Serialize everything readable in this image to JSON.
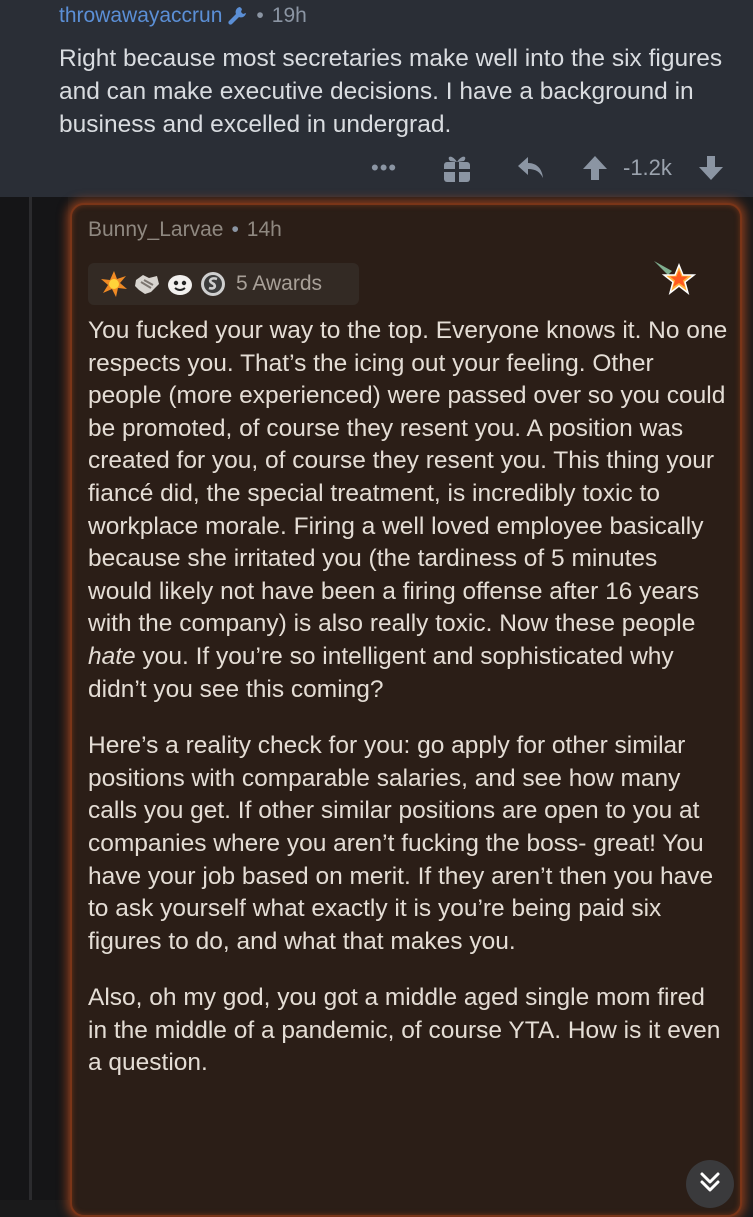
{
  "parent_comment": {
    "username": "throwawayaccrun",
    "separator": "•",
    "age": "19h",
    "body": "Right because most secretaries make well into the six figures and can make executive decisions. I have a background in business and excelled in undergrad.",
    "score": "-1.2k",
    "more_label": "•••"
  },
  "comment": {
    "username": "Bunny_Larvae",
    "separator": "•",
    "age": "14h",
    "awards_label": "5 Awards",
    "award_icons": [
      "explosion-award-icon",
      "handshake-award-icon",
      "face-award-icon",
      "silver-award-icon"
    ],
    "paragraph_1_before": "You fucked your way to the top. Everyone knows it. No one respects you. That’s the icing out your feeling. Other people (more experienced) were passed over so you could be promoted, of course they resent you. A position was created for you, of course they resent you. This thing your fiancé did, the special treatment, is incredibly toxic to workplace morale. Firing a well loved employee basically because she irritated you (the tardiness of 5 minutes would likely not have been a firing offense after 16 years with the company) is also really toxic. Now these people ",
    "paragraph_1_emphasis": "hate",
    "paragraph_1_after": " you. If you’re so intelligent and sophisticated why didn’t you see this coming?",
    "paragraph_2": "Here’s a reality check for you: go apply for other similar positions with comparable salaries, and see how many calls you get. If other similar positions are open to you at companies where you aren’t fucking the boss- great! You have your job based on merit. If they aren’t then you have to ask yourself what exactly it is you’re being paid six figures to do, and what that makes you.",
    "paragraph_3": "Also, oh my god, you got a middle aged single mom fired in the middle of a pandemic, of course YTA. How is it even a question."
  },
  "colors": {
    "page_bg": "#1a1a1b",
    "parent_bg": "#2a2e36",
    "username_blue": "#5b8fd6",
    "highlight_bg": "#2b1e17",
    "highlight_glow": "#e65a1e"
  }
}
